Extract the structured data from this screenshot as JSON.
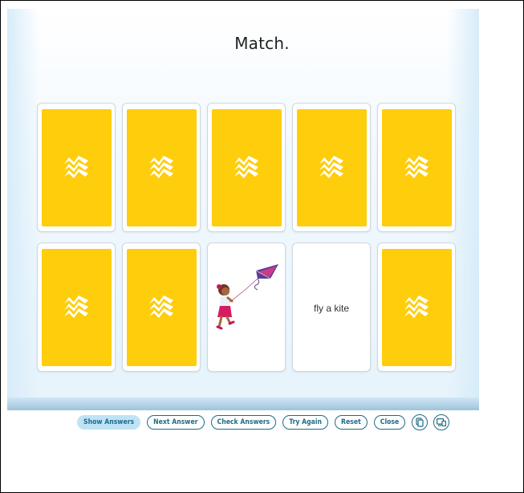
{
  "title": "Match.",
  "cards": [
    {
      "state": "face-down",
      "icon": "publisher-logo-icon"
    },
    {
      "state": "face-down",
      "icon": "publisher-logo-icon"
    },
    {
      "state": "face-down",
      "icon": "publisher-logo-icon"
    },
    {
      "state": "face-down",
      "icon": "publisher-logo-icon"
    },
    {
      "state": "face-down",
      "icon": "publisher-logo-icon"
    },
    {
      "state": "face-down",
      "icon": "publisher-logo-icon"
    },
    {
      "state": "face-down",
      "icon": "publisher-logo-icon"
    },
    {
      "state": "face-up",
      "image": "girl-flying-kite"
    },
    {
      "state": "face-up",
      "text": "fly a kite"
    },
    {
      "state": "face-down",
      "icon": "publisher-logo-icon"
    }
  ],
  "toolbar": {
    "show_answers": "Show Answers",
    "next_answer": "Next Answer",
    "check_answers": "Check Answers",
    "try_again": "Try Again",
    "reset": "Reset",
    "close": "Close",
    "icons": [
      "copy-icon",
      "device-icon"
    ]
  },
  "colors": {
    "card_back": "#fecd0c",
    "accent": "#1f6b86",
    "primary_button_bg": "#bfe3f6"
  }
}
